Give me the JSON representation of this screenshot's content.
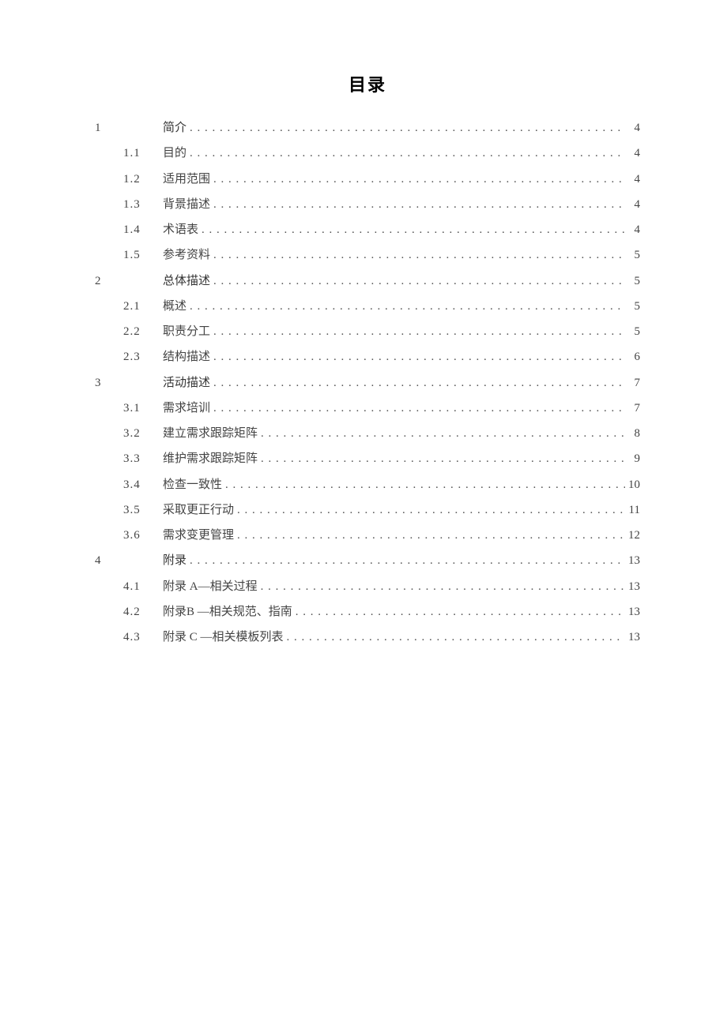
{
  "title": "目录",
  "entries": [
    {
      "level": 1,
      "num": "1",
      "sub": "",
      "text": "简介",
      "page": "4"
    },
    {
      "level": 2,
      "num": "",
      "sub": "1.1",
      "text": "目的",
      "page": "4"
    },
    {
      "level": 2,
      "num": "",
      "sub": "1.2",
      "text": "适用范围",
      "page": "4"
    },
    {
      "level": 2,
      "num": "",
      "sub": "1.3",
      "text": "背景描述",
      "page": "4"
    },
    {
      "level": 2,
      "num": "",
      "sub": "1.4",
      "text": "术语表",
      "page": "4"
    },
    {
      "level": 2,
      "num": "",
      "sub": "1.5",
      "text": "参考资料",
      "page": "5"
    },
    {
      "level": 1,
      "num": "2",
      "sub": "",
      "text": "总体描述",
      "page": "5"
    },
    {
      "level": 2,
      "num": "",
      "sub": "2.1",
      "text": "概述",
      "page": "5"
    },
    {
      "level": 2,
      "num": "",
      "sub": "2.2",
      "text": "职责分工",
      "page": "5"
    },
    {
      "level": 2,
      "num": "",
      "sub": "2.3",
      "text": "结构描述",
      "page": "6"
    },
    {
      "level": 1,
      "num": "3",
      "sub": "",
      "text": "活动描述",
      "page": "7"
    },
    {
      "level": 2,
      "num": "",
      "sub": "3.1",
      "text": "需求培训",
      "page": "7"
    },
    {
      "level": 2,
      "num": "",
      "sub": "3.2",
      "text": "建立需求跟踪矩阵",
      "page": "8"
    },
    {
      "level": 2,
      "num": "",
      "sub": "3.3",
      "text": "维护需求跟踪矩阵",
      "page": "9"
    },
    {
      "level": 2,
      "num": "",
      "sub": "3.4",
      "text": "检查一致性",
      "page": "10"
    },
    {
      "level": 2,
      "num": "",
      "sub": "3.5",
      "text": "采取更正行动",
      "page": "11"
    },
    {
      "level": 2,
      "num": "",
      "sub": "3.6",
      "text": "需求变更管理",
      "page": "12"
    },
    {
      "level": 1,
      "num": "4",
      "sub": "",
      "text": "附录",
      "page": "13"
    },
    {
      "level": 2,
      "num": "",
      "sub": "4.1",
      "text": "附录 A—相关过程",
      "page": "13"
    },
    {
      "level": 2,
      "num": "",
      "sub": "4.2",
      "text": "附录B —相关规范、指南",
      "page": "13"
    },
    {
      "level": 2,
      "num": "",
      "sub": "4.3",
      "text": "附录 C —相关模板列表",
      "page": "13"
    }
  ]
}
